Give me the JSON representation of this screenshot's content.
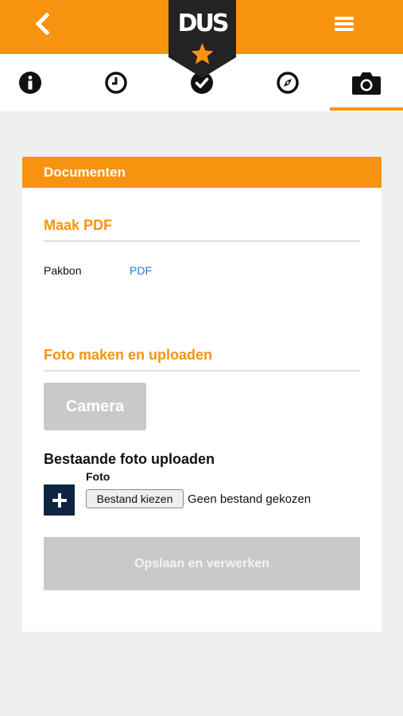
{
  "header": {
    "logo_text": "DUS",
    "back_icon": "chevron-left-icon",
    "menu_icon": "hamburger-menu-icon",
    "accent_color": "#f7930f",
    "badge_color": "#232323"
  },
  "tabs": [
    {
      "icon": "info-icon",
      "active": false
    },
    {
      "icon": "clock-icon",
      "active": false
    },
    {
      "icon": "check-circle-icon",
      "active": false
    },
    {
      "icon": "compass-icon",
      "active": false
    },
    {
      "icon": "camera-icon",
      "active": true
    }
  ],
  "card": {
    "title": "Documenten",
    "make_pdf": {
      "title": "Maak PDF",
      "row_label": "Pakbon",
      "link_text": "PDF"
    },
    "photo": {
      "title": "Foto maken en uploaden",
      "camera_label": "Camera"
    },
    "upload": {
      "title": "Bestaande foto uploaden",
      "field_label": "Foto",
      "choose_file_label": "Bestand kiezen",
      "no_file_text": "Geen bestand gekozen",
      "plus_icon": "plus-icon"
    },
    "save_label": "Opslaan en verwerken"
  },
  "colors": {
    "link": "#1a7fd4",
    "disabled_button": "#c9c9c9",
    "plus_button": "#0d2440"
  }
}
